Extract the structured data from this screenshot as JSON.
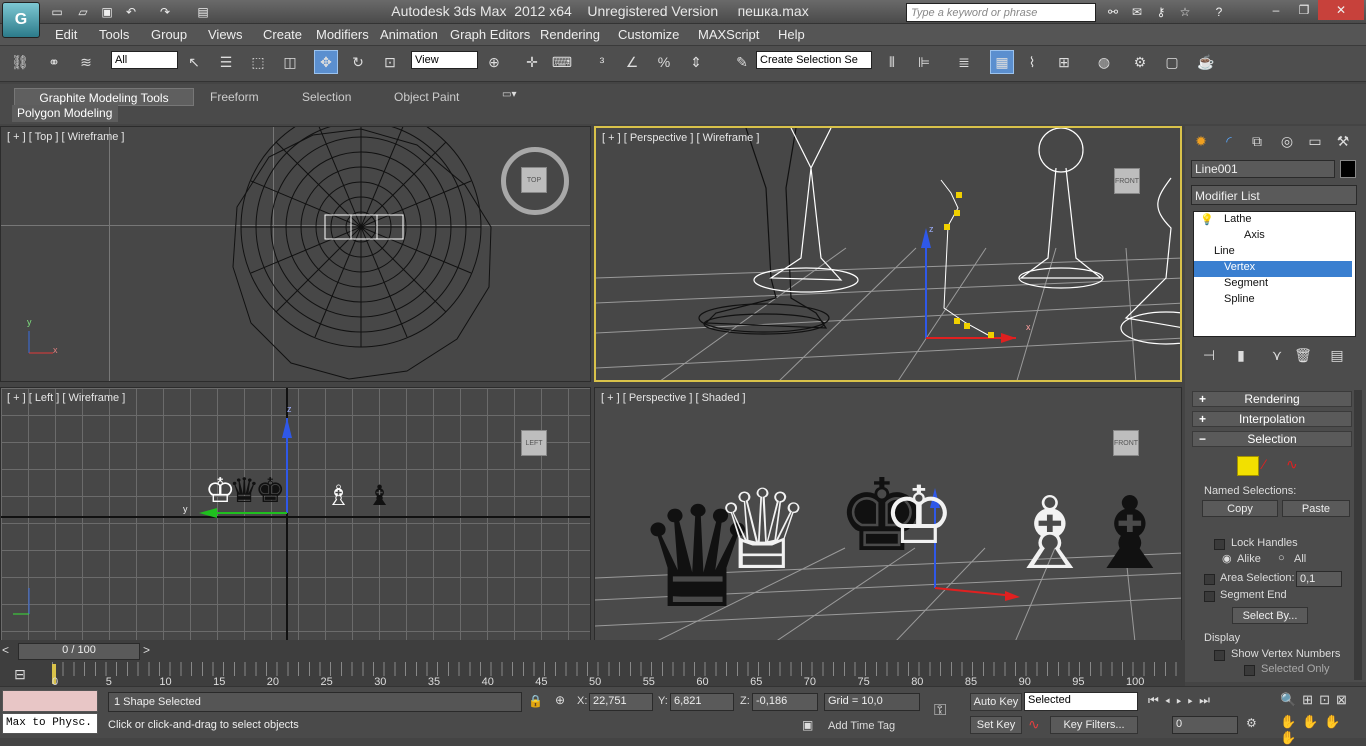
{
  "title": {
    "text": "Autodesk 3ds Max  2012 x64    Unregistered Version     пешка.max",
    "search_placeholder": "Type a keyword or phrase"
  },
  "menu": [
    "Edit",
    "Tools",
    "Group",
    "Views",
    "Create",
    "Modifiers",
    "Animation",
    "Graph Editors",
    "Rendering",
    "Customize",
    "MAXScript",
    "Help"
  ],
  "toolbar": {
    "filter": "All",
    "view": "View",
    "named_sel": "Create Selection Se"
  },
  "ribbon": {
    "tabs": [
      "Graphite Modeling Tools",
      "Freeform",
      "Selection",
      "Object Paint"
    ],
    "panel": "Polygon Modeling"
  },
  "viewports": {
    "top": "[ + ] [ Top ] [ Wireframe ]",
    "persp1": "[ + ] [ Perspective ] [ Wireframe ]",
    "left": "[ + ] [ Left ] [ Wireframe ]",
    "persp2": "[ + ] [ Perspective ] [ Shaded ]",
    "cube_top": "TOP",
    "cube_front": "FRONT",
    "cube_left": "LEFT",
    "axes": {
      "x": "x",
      "y": "y",
      "z": "z"
    }
  },
  "panel": {
    "object_name": "Line001",
    "modifier_list": "Modifier List",
    "stack": {
      "lathe": "Lathe",
      "axis": "Axis",
      "line": "Line",
      "vertex": "Vertex",
      "segment": "Segment",
      "spline": "Spline"
    },
    "rollouts": {
      "rendering": "Rendering",
      "interpolation": "Interpolation",
      "selection": "Selection"
    },
    "named_selections": "Named Selections:",
    "copy": "Copy",
    "paste": "Paste",
    "lock_handles": "Lock Handles",
    "alike": "Alike",
    "all": "All",
    "area_selection": "Area Selection:",
    "area_value": "0,1",
    "segment_end": "Segment End",
    "select_by": "Select By...",
    "display": "Display",
    "show_vertex_numbers": "Show Vertex Numbers",
    "selected_only": "Selected Only"
  },
  "timeline": {
    "frame": "0 / 100",
    "ticks": [
      "0",
      "5",
      "10",
      "15",
      "20",
      "25",
      "30",
      "35",
      "40",
      "45",
      "50",
      "55",
      "60",
      "65",
      "70",
      "75",
      "80",
      "85",
      "90",
      "95",
      "100"
    ]
  },
  "status": {
    "script": "Max to Physc.",
    "selected": "1 Shape Selected",
    "prompt": "Click or click-and-drag to select objects",
    "x": "22,751",
    "y": "6,821",
    "z": "-0,186",
    "grid": "Grid = 10,0",
    "add_time_tag": "Add Time Tag",
    "auto_key": "Auto Key",
    "set_key": "Set Key",
    "selected_drop": "Selected",
    "key_filters": "Key Filters...",
    "frame_field": "0",
    "x_label": "X:",
    "y_label": "Y:",
    "z_label": "Z:"
  }
}
